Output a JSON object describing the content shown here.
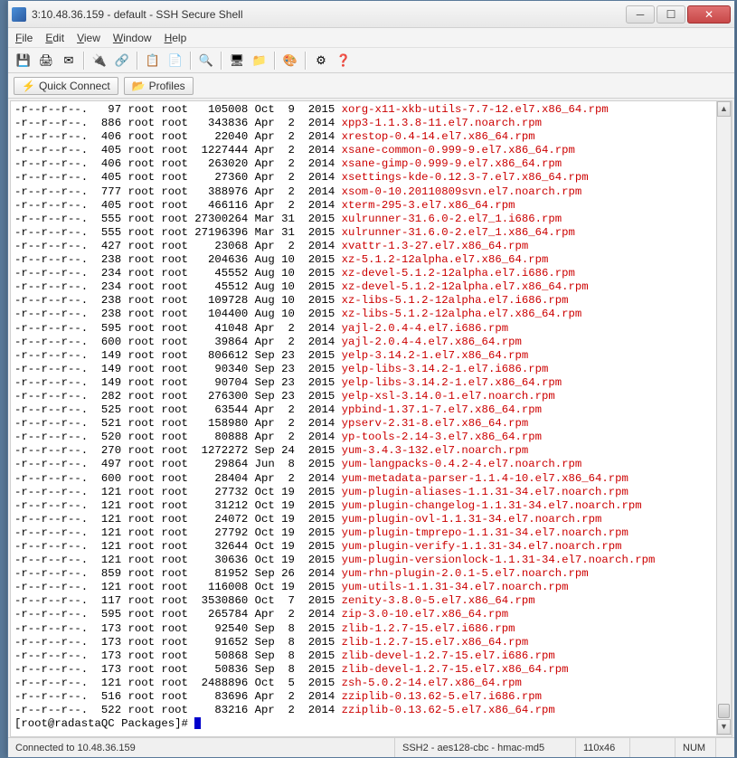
{
  "window": {
    "title": "3:10.48.36.159 - default - SSH Secure Shell"
  },
  "menu": {
    "file": "File",
    "edit": "Edit",
    "view": "View",
    "window": "Window",
    "help": "Help"
  },
  "connectbar": {
    "quick_connect": "Quick Connect",
    "profiles": "Profiles"
  },
  "terminal": {
    "rows": [
      {
        "perm": "-r--r--r--.   97 root root   105008 Oct  9  2015 ",
        "file": "xorg-x11-xkb-utils-7.7-12.el7.x86_64.rpm"
      },
      {
        "perm": "-r--r--r--.  886 root root   343836 Apr  2  2014 ",
        "file": "xpp3-1.1.3.8-11.el7.noarch.rpm"
      },
      {
        "perm": "-r--r--r--.  406 root root    22040 Apr  2  2014 ",
        "file": "xrestop-0.4-14.el7.x86_64.rpm"
      },
      {
        "perm": "-r--r--r--.  405 root root  1227444 Apr  2  2014 ",
        "file": "xsane-common-0.999-9.el7.x86_64.rpm"
      },
      {
        "perm": "-r--r--r--.  406 root root   263020 Apr  2  2014 ",
        "file": "xsane-gimp-0.999-9.el7.x86_64.rpm"
      },
      {
        "perm": "-r--r--r--.  405 root root    27360 Apr  2  2014 ",
        "file": "xsettings-kde-0.12.3-7.el7.x86_64.rpm"
      },
      {
        "perm": "-r--r--r--.  777 root root   388976 Apr  2  2014 ",
        "file": "xsom-0-10.20110809svn.el7.noarch.rpm"
      },
      {
        "perm": "-r--r--r--.  405 root root   466116 Apr  2  2014 ",
        "file": "xterm-295-3.el7.x86_64.rpm"
      },
      {
        "perm": "-r--r--r--.  555 root root 27300264 Mar 31  2015 ",
        "file": "xulrunner-31.6.0-2.el7_1.i686.rpm"
      },
      {
        "perm": "-r--r--r--.  555 root root 27196396 Mar 31  2015 ",
        "file": "xulrunner-31.6.0-2.el7_1.x86_64.rpm"
      },
      {
        "perm": "-r--r--r--.  427 root root    23068 Apr  2  2014 ",
        "file": "xvattr-1.3-27.el7.x86_64.rpm"
      },
      {
        "perm": "-r--r--r--.  238 root root   204636 Aug 10  2015 ",
        "file": "xz-5.1.2-12alpha.el7.x86_64.rpm"
      },
      {
        "perm": "-r--r--r--.  234 root root    45552 Aug 10  2015 ",
        "file": "xz-devel-5.1.2-12alpha.el7.i686.rpm"
      },
      {
        "perm": "-r--r--r--.  234 root root    45512 Aug 10  2015 ",
        "file": "xz-devel-5.1.2-12alpha.el7.x86_64.rpm"
      },
      {
        "perm": "-r--r--r--.  238 root root   109728 Aug 10  2015 ",
        "file": "xz-libs-5.1.2-12alpha.el7.i686.rpm"
      },
      {
        "perm": "-r--r--r--.  238 root root   104400 Aug 10  2015 ",
        "file": "xz-libs-5.1.2-12alpha.el7.x86_64.rpm"
      },
      {
        "perm": "-r--r--r--.  595 root root    41048 Apr  2  2014 ",
        "file": "yajl-2.0.4-4.el7.i686.rpm"
      },
      {
        "perm": "-r--r--r--.  600 root root    39864 Apr  2  2014 ",
        "file": "yajl-2.0.4-4.el7.x86_64.rpm"
      },
      {
        "perm": "-r--r--r--.  149 root root   806612 Sep 23  2015 ",
        "file": "yelp-3.14.2-1.el7.x86_64.rpm"
      },
      {
        "perm": "-r--r--r--.  149 root root    90340 Sep 23  2015 ",
        "file": "yelp-libs-3.14.2-1.el7.i686.rpm"
      },
      {
        "perm": "-r--r--r--.  149 root root    90704 Sep 23  2015 ",
        "file": "yelp-libs-3.14.2-1.el7.x86_64.rpm"
      },
      {
        "perm": "-r--r--r--.  282 root root   276300 Sep 23  2015 ",
        "file": "yelp-xsl-3.14.0-1.el7.noarch.rpm"
      },
      {
        "perm": "-r--r--r--.  525 root root    63544 Apr  2  2014 ",
        "file": "ypbind-1.37.1-7.el7.x86_64.rpm"
      },
      {
        "perm": "-r--r--r--.  521 root root   158980 Apr  2  2014 ",
        "file": "ypserv-2.31-8.el7.x86_64.rpm"
      },
      {
        "perm": "-r--r--r--.  520 root root    80888 Apr  2  2014 ",
        "file": "yp-tools-2.14-3.el7.x86_64.rpm"
      },
      {
        "perm": "-r--r--r--.  270 root root  1272272 Sep 24  2015 ",
        "file": "yum-3.4.3-132.el7.noarch.rpm"
      },
      {
        "perm": "-r--r--r--.  497 root root    29864 Jun  8  2015 ",
        "file": "yum-langpacks-0.4.2-4.el7.noarch.rpm"
      },
      {
        "perm": "-r--r--r--.  600 root root    28404 Apr  2  2014 ",
        "file": "yum-metadata-parser-1.1.4-10.el7.x86_64.rpm"
      },
      {
        "perm": "-r--r--r--.  121 root root    27732 Oct 19  2015 ",
        "file": "yum-plugin-aliases-1.1.31-34.el7.noarch.rpm"
      },
      {
        "perm": "-r--r--r--.  121 root root    31212 Oct 19  2015 ",
        "file": "yum-plugin-changelog-1.1.31-34.el7.noarch.rpm"
      },
      {
        "perm": "-r--r--r--.  121 root root    24072 Oct 19  2015 ",
        "file": "yum-plugin-ovl-1.1.31-34.el7.noarch.rpm"
      },
      {
        "perm": "-r--r--r--.  121 root root    27792 Oct 19  2015 ",
        "file": "yum-plugin-tmprepo-1.1.31-34.el7.noarch.rpm"
      },
      {
        "perm": "-r--r--r--.  121 root root    32644 Oct 19  2015 ",
        "file": "yum-plugin-verify-1.1.31-34.el7.noarch.rpm"
      },
      {
        "perm": "-r--r--r--.  121 root root    30636 Oct 19  2015 ",
        "file": "yum-plugin-versionlock-1.1.31-34.el7.noarch.rpm"
      },
      {
        "perm": "-r--r--r--.  859 root root    81952 Sep 26  2014 ",
        "file": "yum-rhn-plugin-2.0.1-5.el7.noarch.rpm"
      },
      {
        "perm": "-r--r--r--.  121 root root   116008 Oct 19  2015 ",
        "file": "yum-utils-1.1.31-34.el7.noarch.rpm"
      },
      {
        "perm": "-r--r--r--.  117 root root  3530860 Oct  7  2015 ",
        "file": "zenity-3.8.0-5.el7.x86_64.rpm"
      },
      {
        "perm": "-r--r--r--.  595 root root   265784 Apr  2  2014 ",
        "file": "zip-3.0-10.el7.x86_64.rpm"
      },
      {
        "perm": "-r--r--r--.  173 root root    92540 Sep  8  2015 ",
        "file": "zlib-1.2.7-15.el7.i686.rpm"
      },
      {
        "perm": "-r--r--r--.  173 root root    91652 Sep  8  2015 ",
        "file": "zlib-1.2.7-15.el7.x86_64.rpm"
      },
      {
        "perm": "-r--r--r--.  173 root root    50868 Sep  8  2015 ",
        "file": "zlib-devel-1.2.7-15.el7.i686.rpm"
      },
      {
        "perm": "-r--r--r--.  173 root root    50836 Sep  8  2015 ",
        "file": "zlib-devel-1.2.7-15.el7.x86_64.rpm"
      },
      {
        "perm": "-r--r--r--.  121 root root  2488896 Oct  5  2015 ",
        "file": "zsh-5.0.2-14.el7.x86_64.rpm"
      },
      {
        "perm": "-r--r--r--.  516 root root    83696 Apr  2  2014 ",
        "file": "zziplib-0.13.62-5.el7.i686.rpm"
      },
      {
        "perm": "-r--r--r--.  522 root root    83216 Apr  2  2014 ",
        "file": "zziplib-0.13.62-5.el7.x86_64.rpm"
      }
    ],
    "prompt": "[root@radastaQC Packages]# "
  },
  "statusbar": {
    "connected": "Connected to 10.48.36.159",
    "cipher": "SSH2 - aes128-cbc - hmac-md5",
    "dims": "110x46",
    "num": "NUM"
  }
}
